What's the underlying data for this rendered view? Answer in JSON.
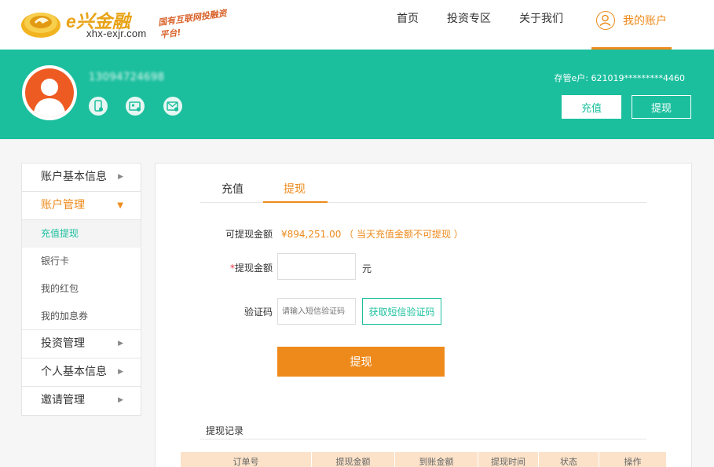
{
  "header": {
    "brand": "e兴金融",
    "domain_text": "xhx-exjr.com",
    "slogan": "国有互联网投融资平台!",
    "nav": [
      {
        "label": "首页"
      },
      {
        "label": "投资专区"
      },
      {
        "label": "关于我们"
      },
      {
        "label": "我的账户",
        "active": true
      }
    ]
  },
  "banner": {
    "username": "13094724698",
    "account_label": "存管e户: 621019*********4460",
    "recharge_label": "充值",
    "withdraw_label": "提现",
    "badges": [
      "phone-verified-icon",
      "id-card-verified-icon",
      "email-verified-icon"
    ]
  },
  "sidebar": {
    "sections": [
      {
        "label": "账户基本信息"
      },
      {
        "label": "账户管理",
        "open": true
      },
      {
        "label": "投资管理"
      },
      {
        "label": "个人基本信息"
      },
      {
        "label": "邀请管理"
      }
    ],
    "sub_items": [
      "充值提现",
      "银行卡",
      "我的红包",
      "我的加息券"
    ]
  },
  "main": {
    "tabs": [
      "充值",
      "提现"
    ],
    "available_label": "可提现金额",
    "available_value": "¥894,251.00 （ 当天充值金额不可提现 ）",
    "amount_label": "提现金额",
    "amount_required_mark": "*",
    "amount_value": "",
    "amount_unit": "元",
    "code_label": "验证码",
    "code_placeholder": "请输入短信验证码",
    "code_button": "获取短信验证码",
    "submit_label": "提现",
    "records_title": "提现记录",
    "table_headers": [
      "订单号",
      "提现金额",
      "到账金额",
      "提现时间",
      "状态",
      "操作"
    ]
  },
  "colors": {
    "teal": "#1bbf9e",
    "orange": "#ee8a1b",
    "avatar": "#ee5b22"
  }
}
